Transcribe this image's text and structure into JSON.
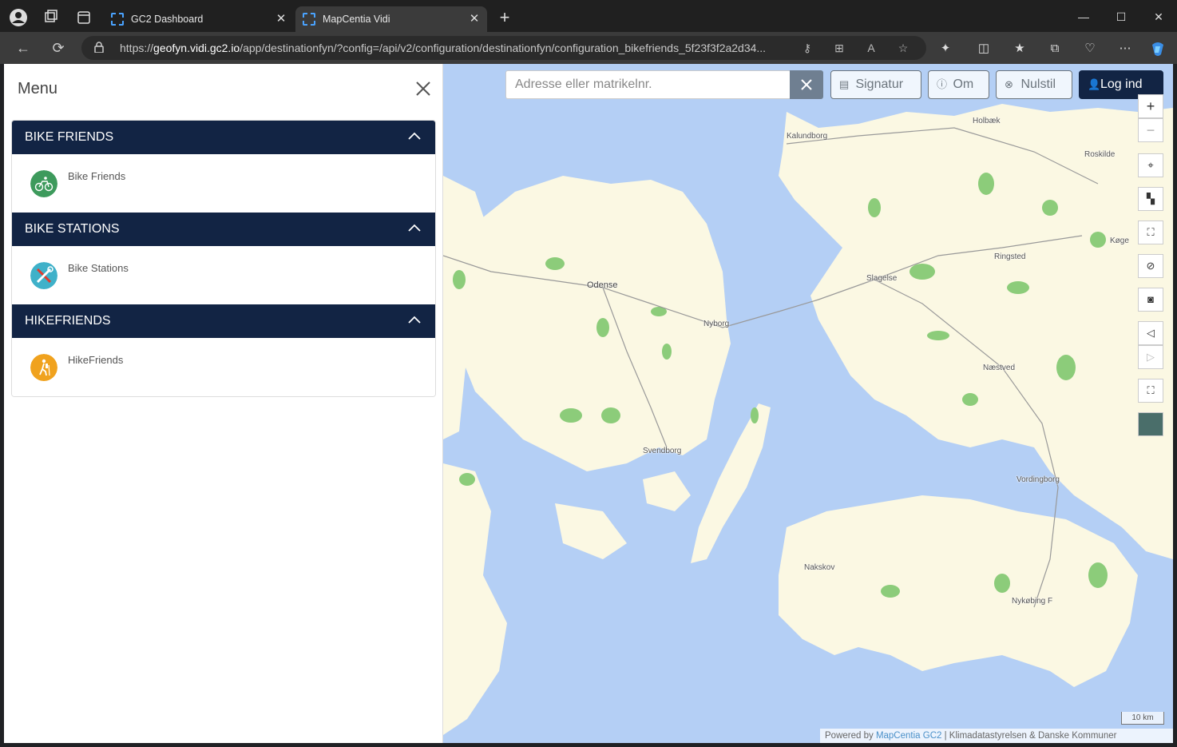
{
  "browser": {
    "tabs": [
      {
        "title": "GC2 Dashboard",
        "active": false
      },
      {
        "title": "MapCentia Vidi",
        "active": true
      }
    ],
    "url_prefix": "https://",
    "url_host": "geofyn.vidi.gc2.io",
    "url_path": "/app/destinationfyn/?config=/api/v2/configuration/destinationfyn/configuration_bikefriends_5f23f3f2a2d34..."
  },
  "menu": {
    "title": "Menu",
    "groups": [
      {
        "header": "BIKE FRIENDS",
        "layer": "Bike Friends",
        "icon": "bicycle-icon",
        "color": "#3d9a5c"
      },
      {
        "header": "BIKE STATIONS",
        "layer": "Bike Stations",
        "icon": "wrench-screwdriver-icon",
        "color": "#3fb1c9"
      },
      {
        "header": "HIKEFRIENDS",
        "layer": "HikeFriends",
        "icon": "hiker-icon",
        "color": "#f0a21e"
      }
    ]
  },
  "map": {
    "search_placeholder": "Adresse eller matrikelnr.",
    "buttons": {
      "signatur": "Signatur",
      "om": "Om",
      "nulstil": "Nulstil",
      "login": "Log ind"
    },
    "places": [
      {
        "name": "Kalundborg"
      },
      {
        "name": "Holbæk"
      },
      {
        "name": "Roskilde"
      },
      {
        "name": "Odense"
      },
      {
        "name": "Nyborg"
      },
      {
        "name": "Slagelse"
      },
      {
        "name": "Ringsted"
      },
      {
        "name": "Køge"
      },
      {
        "name": "Næstved"
      },
      {
        "name": "Svendborg"
      },
      {
        "name": "Vordingborg"
      },
      {
        "name": "Nakskov"
      },
      {
        "name": "Nykøbing F"
      }
    ],
    "scale": "10 km",
    "attribution_prefix": "Powered by",
    "attribution_link": "MapCentia GC2",
    "attribution_suffix": "| Klimadatastyrelsen & Danske Kommuner",
    "colors": {
      "water": "#b4cff5",
      "land": "#fbf8e3",
      "forest": "#8ccc7a",
      "header": "#122444"
    }
  }
}
